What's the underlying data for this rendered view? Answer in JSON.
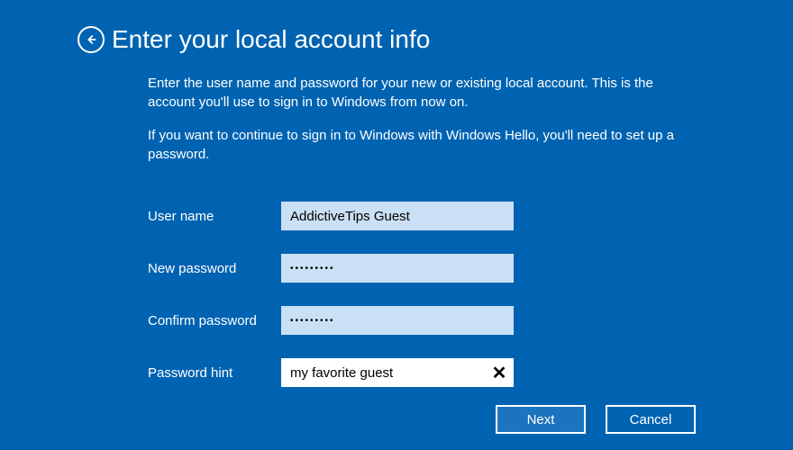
{
  "title": "Enter your local account info",
  "description1": "Enter the user name and password for your new or existing local account. This is the account you'll use to sign in to Windows from now on.",
  "description2": "If you want to continue to sign in to Windows with Windows Hello, you'll need to set up a password.",
  "fields": {
    "username": {
      "label": "User name",
      "value": "AddictiveTips Guest"
    },
    "newPassword": {
      "label": "New password",
      "value": "•••••••••"
    },
    "confirmPassword": {
      "label": "Confirm password",
      "value": "•••••••••"
    },
    "passwordHint": {
      "label": "Password hint",
      "value": "my favorite guest"
    }
  },
  "buttons": {
    "next": "Next",
    "cancel": "Cancel"
  }
}
